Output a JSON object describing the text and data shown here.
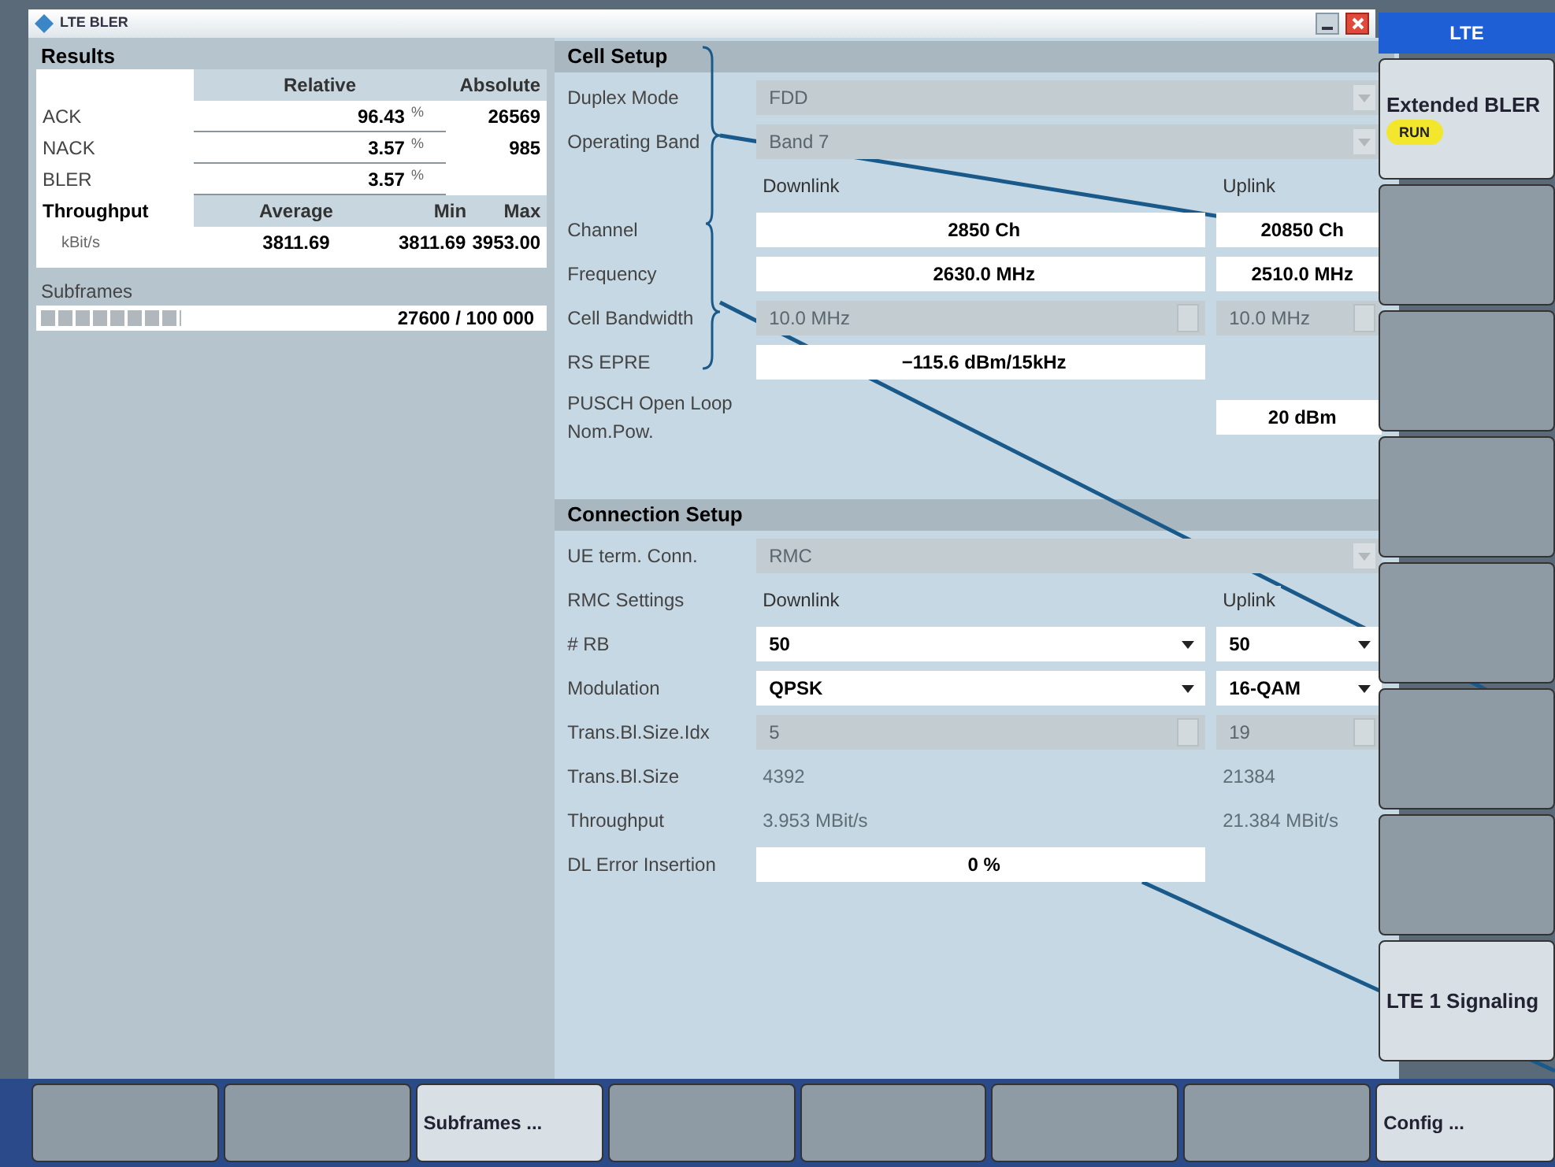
{
  "window": {
    "title": "LTE BLER"
  },
  "results": {
    "title": "Results",
    "header": [
      "Relative",
      "Absolute"
    ],
    "rows": [
      {
        "label": "ACK",
        "relative": "96.43",
        "unit": "%",
        "absolute": "26569"
      },
      {
        "label": "NACK",
        "relative": "3.57",
        "unit": "%",
        "absolute": "985"
      },
      {
        "label": "BLER",
        "relative": "3.57",
        "unit": "%"
      }
    ],
    "throughput": {
      "label": "Throughput",
      "columns": [
        "Average",
        "Min",
        "Max"
      ],
      "unit": "kBit/s",
      "values": [
        "3811.69",
        "3811.69",
        "3953.00"
      ]
    },
    "subframes": {
      "label": "Subframes",
      "level": 0.276,
      "reading": "27600 / 100 000"
    }
  },
  "cell_setup": {
    "title": "Cell Setup",
    "rows": [
      {
        "label": "Duplex Mode",
        "both": {
          "kind": "dropdown",
          "value": "FDD",
          "disabled": true
        }
      },
      {
        "label": "Operating Band",
        "both": {
          "kind": "dropdown",
          "value": "Band 7",
          "disabled": true
        }
      },
      {
        "downlink": {
          "kind": "text",
          "value": "Downlink",
          "disabled": false
        },
        "uplink": {
          "kind": "text",
          "value": "Uplink",
          "disabled": false
        }
      },
      {
        "label": "Channel",
        "downlink": {
          "kind": "input",
          "value": "2850 Ch",
          "disabled": false
        },
        "uplink": {
          "kind": "input",
          "value": "20850 Ch",
          "disabled": false
        }
      },
      {
        "label": "Frequency",
        "downlink": {
          "kind": "input",
          "value": "2630.0 MHz",
          "disabled": false
        },
        "uplink": {
          "kind": "input",
          "value": "2510.0 MHz",
          "disabled": false
        }
      },
      {
        "label": "Cell Bandwidth",
        "downlink": {
          "kind": "spin",
          "value": "10.0 MHz",
          "disabled": true
        },
        "uplink": {
          "kind": "spin",
          "value": "10.0 MHz",
          "disabled": true
        }
      },
      {
        "label": "RS EPRE",
        "downlink": {
          "kind": "input",
          "value": "−115.6 dBm/15kHz",
          "disabled": false
        }
      },
      {
        "label": "PUSCH Open Loop Nom.Pow.",
        "uplink": {
          "kind": "input",
          "value": "20 dBm",
          "disabled": false
        }
      }
    ]
  },
  "connection_setup": {
    "title": "Connection Setup",
    "rows": [
      {
        "label": "UE term. Conn.",
        "both": {
          "kind": "dropdown",
          "value": "RMC",
          "disabled": true
        }
      },
      {
        "label": "RMC Settings",
        "downlink": {
          "kind": "text",
          "value": "Downlink",
          "disabled": false
        },
        "uplink": {
          "kind": "text",
          "value": "Uplink",
          "disabled": false
        }
      },
      {
        "label": "# RB",
        "downlink": {
          "kind": "dropdown",
          "value": "50",
          "disabled": false
        },
        "uplink": {
          "kind": "dropdown",
          "value": "50",
          "disabled": false
        }
      },
      {
        "label": "Modulation",
        "downlink": {
          "kind": "dropdown",
          "value": "QPSK",
          "disabled": false
        },
        "uplink": {
          "kind": "dropdown",
          "value": "16-QAM",
          "disabled": false
        }
      },
      {
        "label": "Trans.Bl.Size.Idx",
        "downlink": {
          "kind": "spin",
          "value": "5",
          "disabled": true
        },
        "uplink": {
          "kind": "spin",
          "value": "19",
          "disabled": true
        }
      },
      {
        "label": "Trans.Bl.Size",
        "downlink": {
          "kind": "text",
          "value": "4392",
          "disabled": true
        },
        "uplink": {
          "kind": "text",
          "value": "21384",
          "disabled": true
        }
      },
      {
        "label": "Throughput",
        "downlink": {
          "kind": "text",
          "value": "3.953 MBit/s",
          "disabled": true
        },
        "uplink": {
          "kind": "text",
          "value": "21.384 MBit/s",
          "disabled": true
        }
      },
      {
        "label": "DL Error Insertion",
        "downlink": {
          "kind": "input",
          "value": "0 %",
          "disabled": false
        }
      }
    ]
  },
  "softkeys": {
    "title": "LTE",
    "keys": [
      {
        "kind": "label",
        "label": "Extended BLER",
        "badge": "RUN"
      },
      {
        "kind": "blank"
      },
      {
        "kind": "blank"
      },
      {
        "kind": "blank"
      },
      {
        "kind": "blank"
      },
      {
        "kind": "blank"
      },
      {
        "kind": "blank"
      },
      {
        "kind": "label",
        "label": "LTE 1 Signaling"
      }
    ]
  },
  "bottom_keys": [
    {
      "kind": "blank"
    },
    {
      "kind": "blank"
    },
    {
      "kind": "label",
      "label": "Subframes ..."
    },
    {
      "kind": "blank"
    },
    {
      "kind": "blank"
    },
    {
      "kind": "blank"
    },
    {
      "kind": "blank"
    },
    {
      "kind": "label",
      "label": "Config ..."
    }
  ]
}
